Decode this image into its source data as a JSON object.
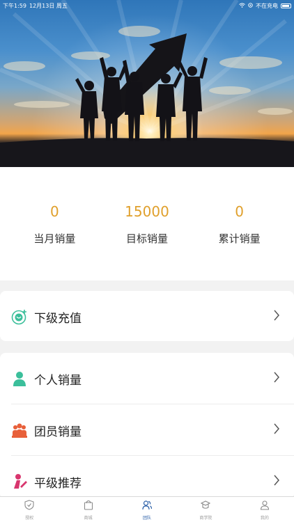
{
  "status_bar": {
    "time": "下午1:59",
    "date": "12月13日 周五",
    "charging": "不在充电"
  },
  "stats": [
    {
      "value": "0",
      "label": "当月销量"
    },
    {
      "value": "15000",
      "label": "目标销量"
    },
    {
      "value": "0",
      "label": "累计销量"
    }
  ],
  "menu_top": [
    {
      "label": "下级充值",
      "icon": "recharge-icon"
    }
  ],
  "menu": [
    {
      "label": "个人销量",
      "icon": "person-icon"
    },
    {
      "label": "团员销量",
      "icon": "team-icon"
    },
    {
      "label": "平级推荐",
      "icon": "recommend-icon"
    }
  ],
  "tabbar": [
    {
      "label": "授权",
      "icon": "shield-icon",
      "active": false
    },
    {
      "label": "商城",
      "icon": "shopping-bag-icon",
      "active": false
    },
    {
      "label": "团队",
      "icon": "team-icon",
      "active": true
    },
    {
      "label": "商学院",
      "icon": "graduation-cap-icon",
      "active": false
    },
    {
      "label": "我的",
      "icon": "user-icon",
      "active": false
    }
  ],
  "colors": {
    "accent": "#e0a02c",
    "tab_active": "#2a5fa8",
    "recharge_icon": "#3bbf9b",
    "person_icon": "#3bbf9b",
    "team_icon": "#e8603a",
    "recommend_icon": "#d8366e"
  }
}
